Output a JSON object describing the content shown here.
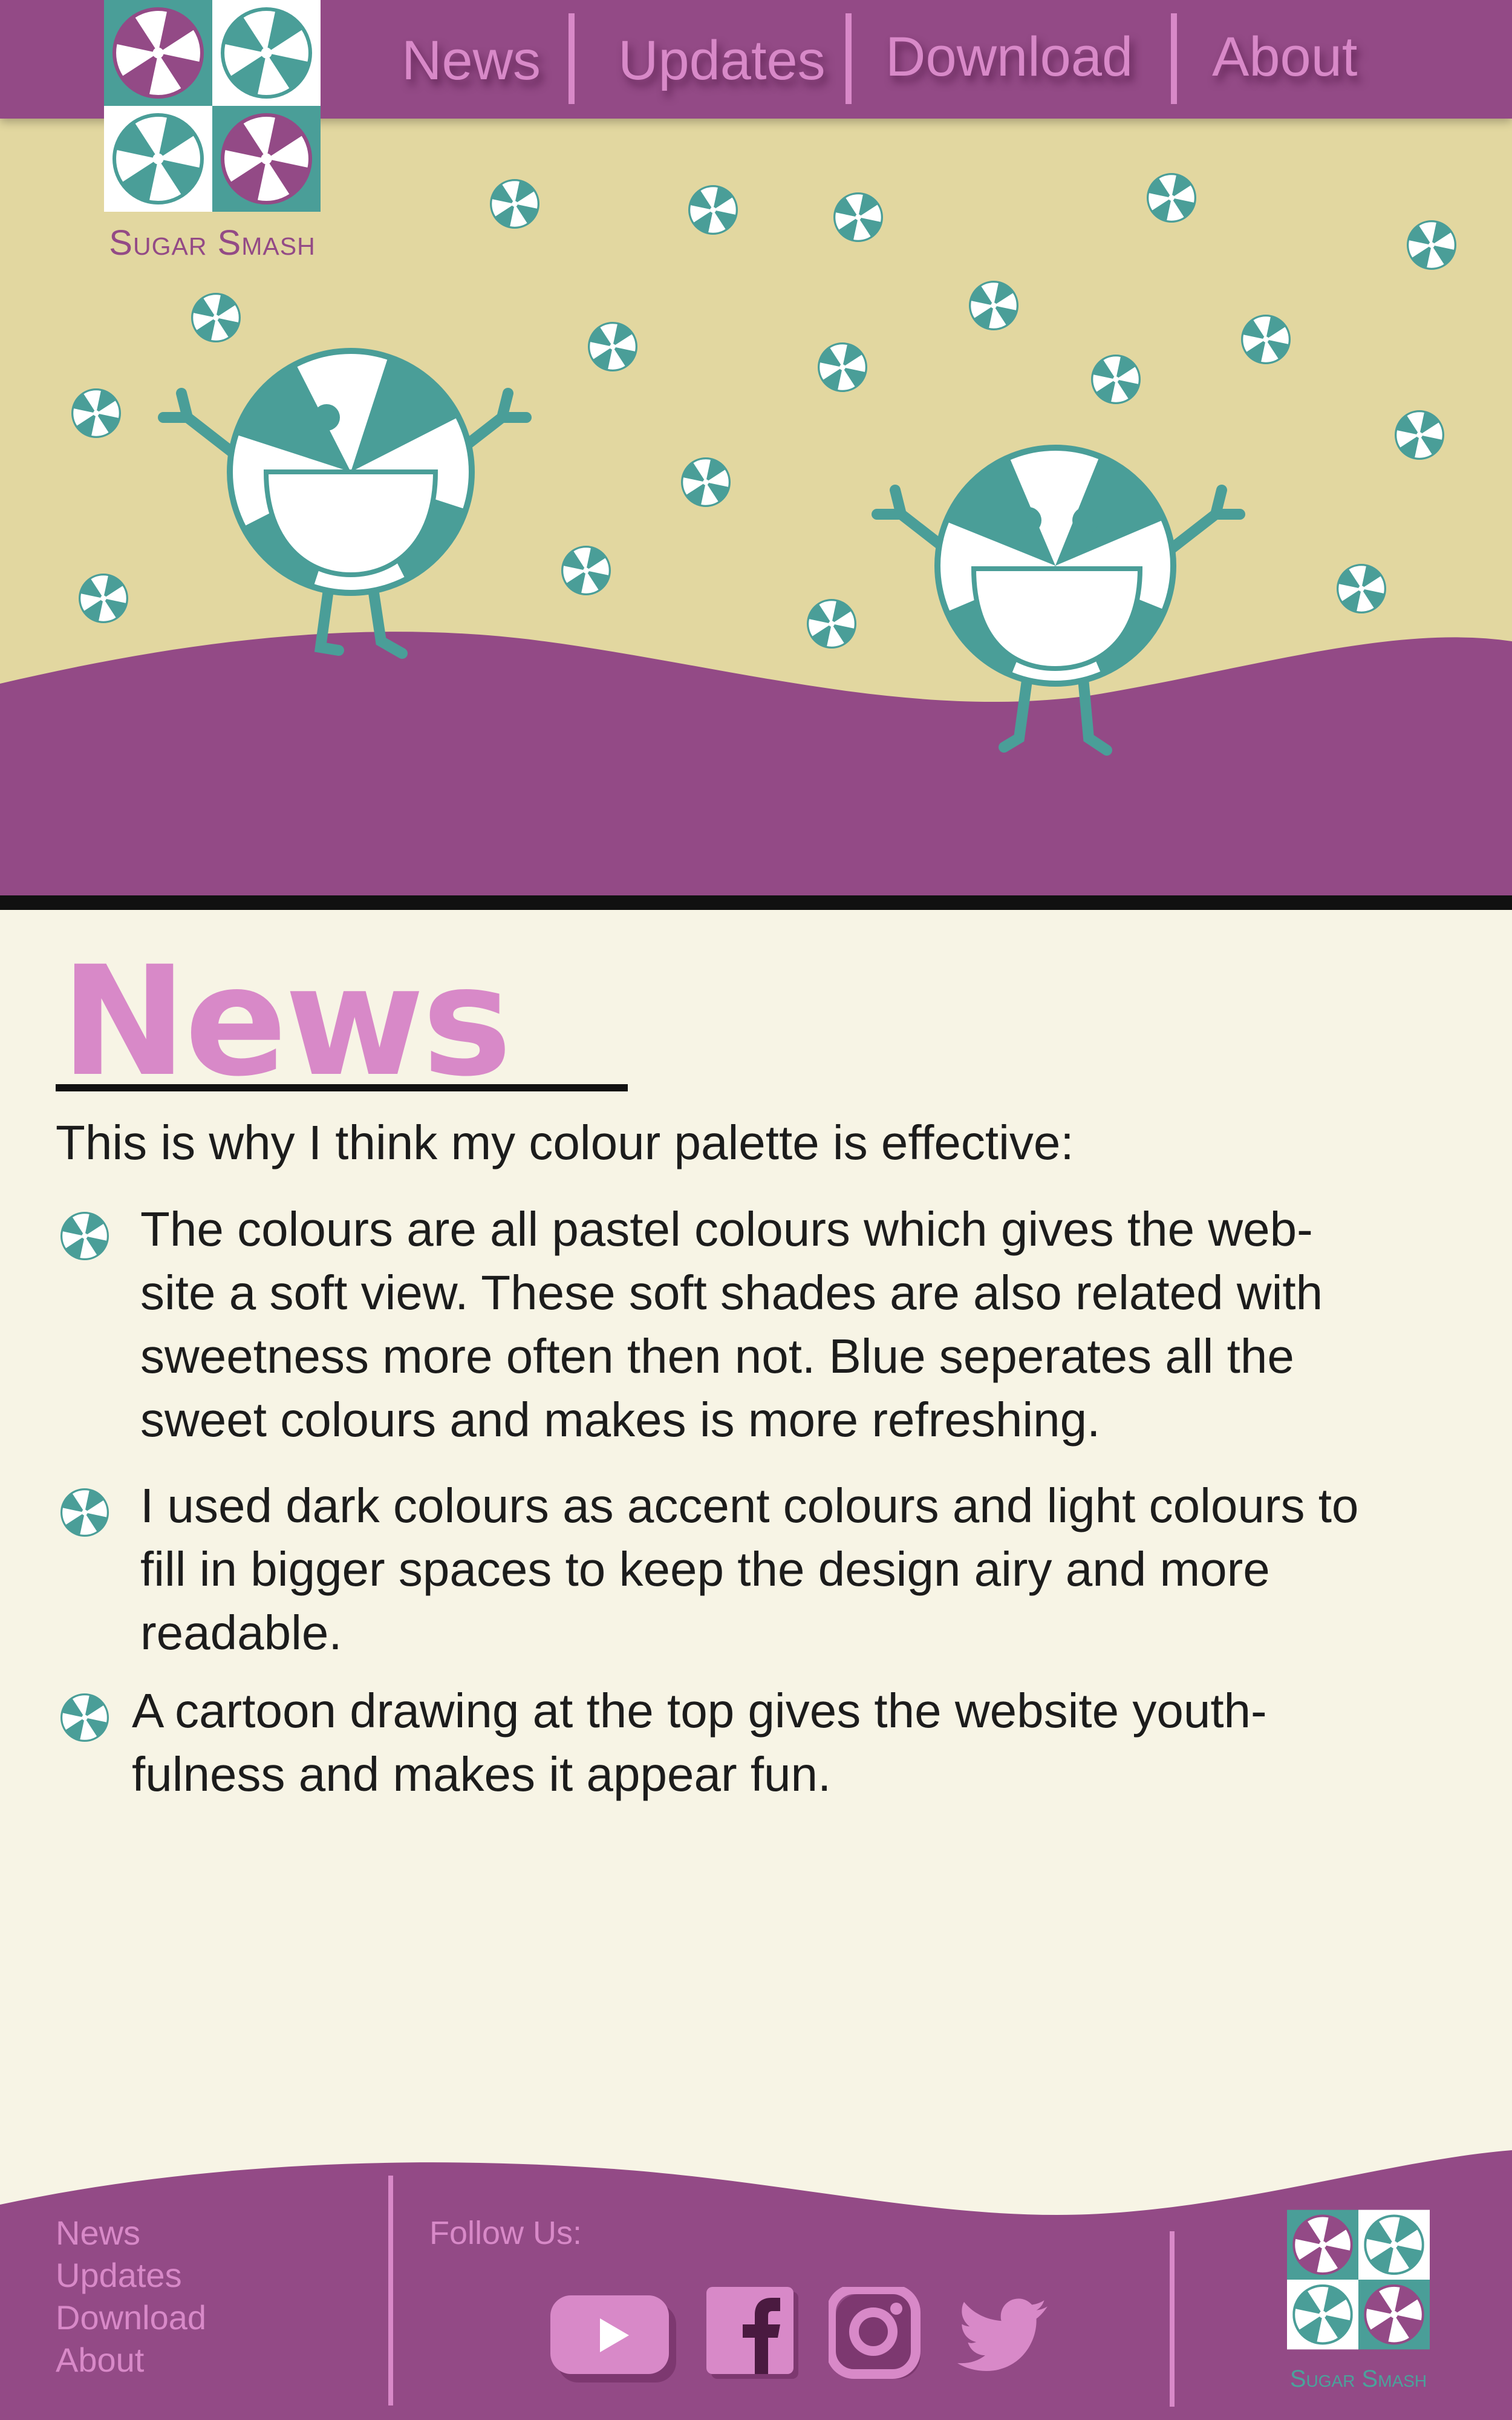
{
  "brand": {
    "name": "Sugar Smash"
  },
  "nav": {
    "items": [
      {
        "label": "News"
      },
      {
        "label": "Updates"
      },
      {
        "label": "Download"
      },
      {
        "label": "About"
      }
    ]
  },
  "colors": {
    "purple": "#934a86",
    "pink": "#d889c8",
    "teal": "#4a9e98",
    "sand": "#e2d7a0",
    "cream": "#f7f4e5"
  },
  "main": {
    "title": "News",
    "intro": "This is why I think my colour palette is effective:",
    "bullets": [
      {
        "text": "The colours are all pastel colours which gives the web-\nsite a soft view. These soft shades are also related with\nsweetness more often then not. Blue seperates all the\nsweet colours and makes is more refreshing."
      },
      {
        "text": "I used dark colours as accent colours and light colours to\nfill in bigger spaces to keep the design airy and more\nreadable."
      },
      {
        "text": "A cartoon drawing at the top gives the website youth-\nfulness and makes it appear fun."
      }
    ],
    "bullet_icon": "peppermint-candy-icon"
  },
  "footer": {
    "links": [
      {
        "label": "News"
      },
      {
        "label": "Updates"
      },
      {
        "label": "Download"
      },
      {
        "label": "About"
      }
    ],
    "follow_label": "Follow Us:",
    "social": [
      {
        "icon": "youtube-icon"
      },
      {
        "icon": "facebook-icon"
      },
      {
        "icon": "instagram-icon"
      },
      {
        "icon": "twitter-icon"
      }
    ],
    "brand": "Sugar Smash"
  }
}
